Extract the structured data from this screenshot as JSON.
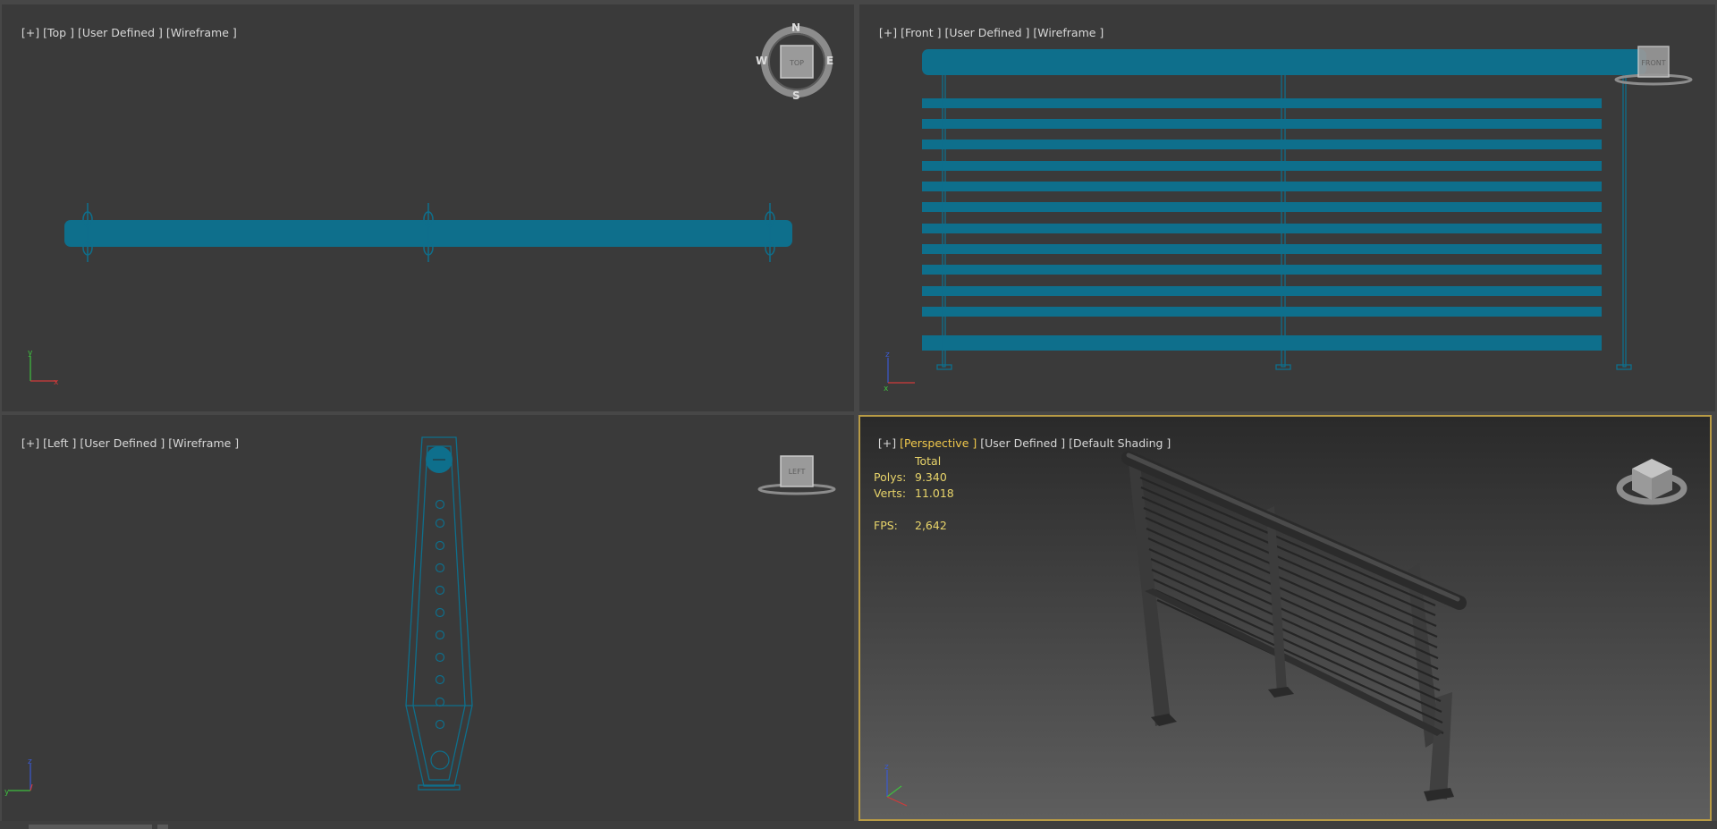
{
  "viewports": {
    "top": {
      "plus": "[+]",
      "view": "[Top ]",
      "mode": "[User Defined ]",
      "shading": "[Wireframe ]",
      "compass": {
        "n": "N",
        "s": "S",
        "e": "E",
        "w": "W",
        "cube": "TOP"
      }
    },
    "front": {
      "plus": "[+]",
      "view": "[Front ]",
      "mode": "[User Defined ]",
      "shading": "[Wireframe ]",
      "cube": "FRONT"
    },
    "left": {
      "plus": "[+]",
      "view": "[Left ]",
      "mode": "[User Defined ]",
      "shading": "[Wireframe ]",
      "cube": "LEFT"
    },
    "perspective": {
      "plus": "[+]",
      "view": "[Perspective ]",
      "mode": "[User Defined ]",
      "shading": "[Default Shading ]",
      "stats": {
        "header": "Total",
        "polys_label": "Polys:",
        "polys": "9.340",
        "verts_label": "Verts:",
        "verts": "11.018",
        "fps_label": "FPS:",
        "fps": "2,642"
      }
    }
  },
  "colors": {
    "viewport_bg": "#3a3a3a",
    "object": "#0e6f8c",
    "active_border": "#b89b45",
    "label_text": "#d8d8d8",
    "stats_text": "#e8d46a"
  }
}
